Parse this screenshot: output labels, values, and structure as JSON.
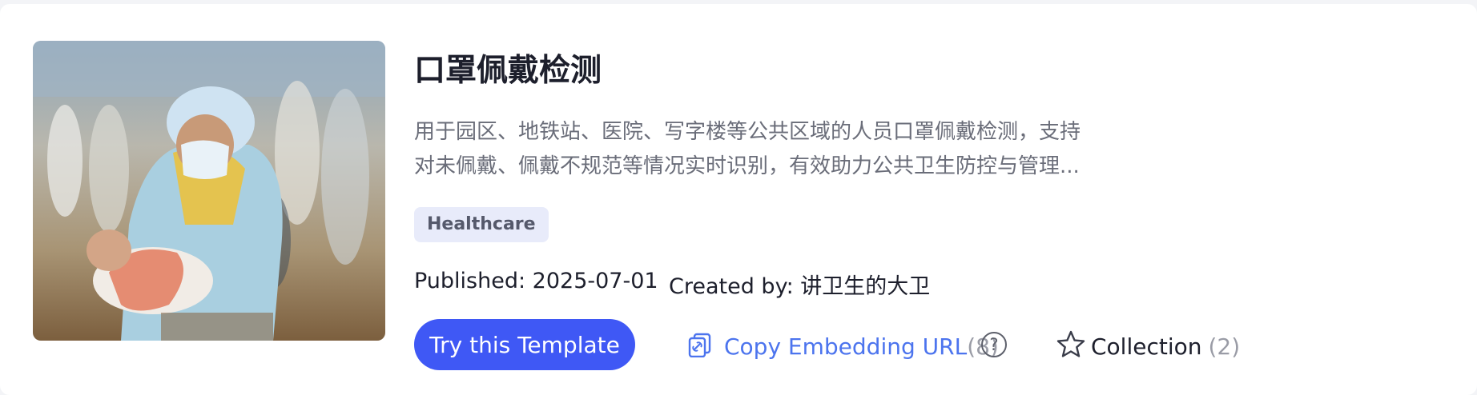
{
  "template": {
    "title": "口罩佩戴检测",
    "description_line1": "用于园区、地铁站、医院、写字楼等公共区域的人员口罩佩戴检测，支持",
    "description_line2": "对未佩戴、佩戴不规范等情况实时识别，有效助力公共卫生防控与管理...",
    "tag": "Healthcare",
    "published": "Published: 2025-07-01",
    "created_by": "Created by: 讲卫生的大卫"
  },
  "actions": {
    "try_label": "Try this Template",
    "embed_label": "Copy Embedding URL",
    "embed_count": "(8)",
    "help_glyph": "?",
    "collection_label": "Collection",
    "collection_count": "(2)"
  },
  "icons": {
    "embed": "link-copy-icon",
    "help": "question-circle-icon",
    "collection": "star-outline-icon"
  },
  "colors": {
    "primary": "#3f58f5",
    "link": "#4c74ee",
    "tag_bg": "#e8ebfa"
  }
}
